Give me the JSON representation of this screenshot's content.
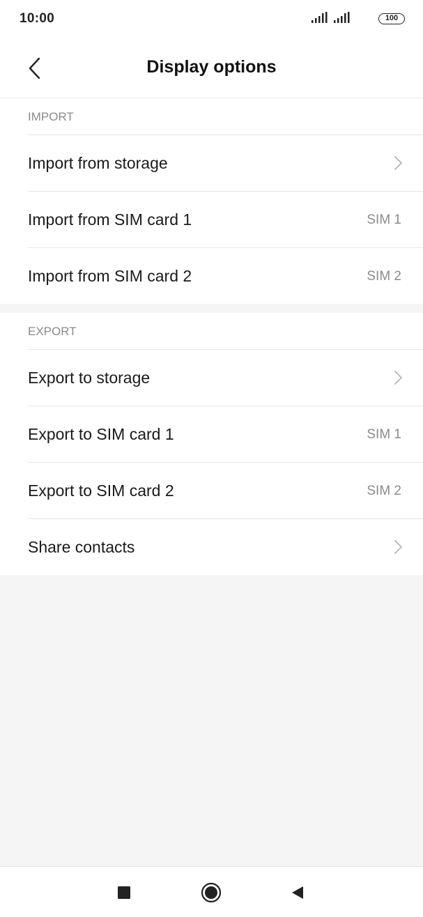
{
  "status_bar": {
    "time": "10:00",
    "battery": "100",
    "icons": [
      "signal-icon",
      "signal-icon",
      "battery-icon"
    ]
  },
  "header": {
    "title": "Display options",
    "back_icon": "chevron-left-icon"
  },
  "import_section": {
    "title": "IMPORT",
    "items": [
      {
        "label": "Import from storage",
        "value": "",
        "icon": "chevron-right-icon"
      },
      {
        "label": "Import from SIM card 1",
        "value": "SIM 1"
      },
      {
        "label": "Import from SIM card 2",
        "value": "SIM 2"
      }
    ]
  },
  "export_section": {
    "title": "EXPORT",
    "items": [
      {
        "label": "Export to storage",
        "value": "",
        "icon": "chevron-right-icon"
      },
      {
        "label": "Export to SIM card 1",
        "value": "SIM 1"
      },
      {
        "label": "Export to SIM card 2",
        "value": "SIM 2"
      },
      {
        "label": "Share contacts",
        "value": "",
        "icon": "chevron-right-icon"
      }
    ]
  },
  "nav_bar": {
    "buttons": [
      "recent-apps-icon",
      "home-icon",
      "back-triangle-icon"
    ]
  },
  "colors": {
    "background": "#f5f5f5",
    "surface": "#ffffff",
    "secondary_text": "#8a8a8a",
    "divider": "#e6e6e6"
  }
}
